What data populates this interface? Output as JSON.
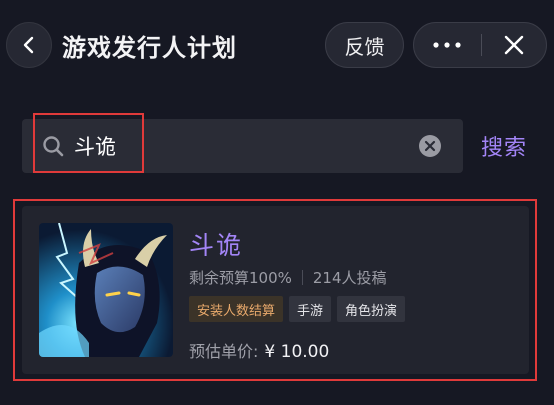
{
  "header": {
    "title": "游戏发行人计划",
    "feedback_label": "反馈"
  },
  "search": {
    "query": "斗诡",
    "button_label": "搜索"
  },
  "result": {
    "name": "斗诡",
    "budget_text": "剩余预算100%",
    "submissions_text": "214人投稿",
    "tags": [
      "安装人数结算",
      "手游",
      "角色扮演"
    ],
    "price_label": "预估单价:",
    "price_value": "¥ 10.00"
  },
  "colors": {
    "accent": "#a385f7",
    "background": "#161823",
    "card": "#22242e",
    "tag_primary_text": "#e8a96b",
    "highlight_border": "#e03a3a"
  },
  "icons": [
    "chevron-left-icon",
    "more-horizontal-icon",
    "close-icon",
    "search-icon",
    "clear-icon"
  ]
}
